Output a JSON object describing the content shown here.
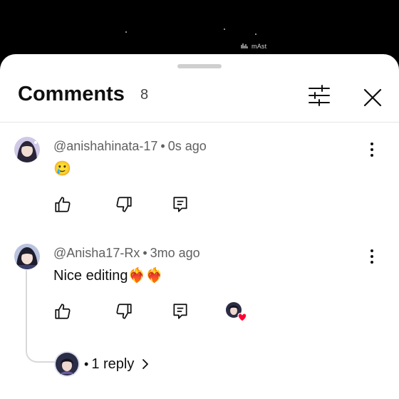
{
  "video": {
    "watermark": "mAst"
  },
  "comments_panel": {
    "title": "Comments",
    "count": "8"
  },
  "comments": [
    {
      "author": "@anishahinata-17",
      "time": "0s ago",
      "text": "🥲"
    },
    {
      "author": "@Anisha17-Rx",
      "time": "3mo ago",
      "text": "Nice editing❤️‍🔥❤️‍🔥",
      "reply_label": "1 reply"
    }
  ],
  "icons": {
    "filter": "sliders-icon",
    "close": "close-icon",
    "more": "more-vert-icon",
    "like": "thumb-up-icon",
    "dislike": "thumb-down-icon",
    "reply": "reply-icon",
    "creator_heart": "creator-heart-icon",
    "chevron": "chevron-right-icon"
  },
  "colors": {
    "heart": "#ff0033",
    "text": "#0f0f0f",
    "meta": "#606060"
  }
}
